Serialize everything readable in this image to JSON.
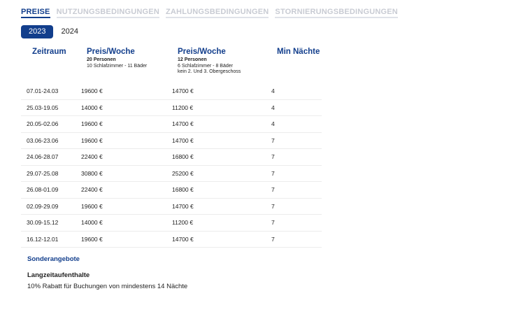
{
  "tabs": [
    {
      "label": "PREISE",
      "active": true
    },
    {
      "label": "NUTZUNGSBEDINGUNGEN",
      "active": false
    },
    {
      "label": "ZAHLUNGSBEDINGUNGEN",
      "active": false
    },
    {
      "label": "STORNIERUNGSBEDINGUNGEN",
      "active": false
    }
  ],
  "years": [
    {
      "label": "2023",
      "active": true
    },
    {
      "label": "2024",
      "active": false
    }
  ],
  "headers": {
    "period": {
      "title": "Zeitraum"
    },
    "price1": {
      "title": "Preis/Woche",
      "persons": "20 Personen",
      "details": [
        "10 Schlafzimmer - 11 Bäder"
      ]
    },
    "price2": {
      "title": "Preis/Woche",
      "persons": "12 Personen",
      "details": [
        "6 Schlafzimmer - 8 Bäder",
        "kein 2. Und 3. Obergeschoss"
      ]
    },
    "min_nights": {
      "title": "Min Nächte"
    }
  },
  "rows": [
    {
      "period": "07.01-24.03",
      "price1": "19600 €",
      "price2": "14700 €",
      "min": "4"
    },
    {
      "period": "25.03-19.05",
      "price1": "14000 €",
      "price2": "11200 €",
      "min": "4"
    },
    {
      "period": "20.05-02.06",
      "price1": "19600 €",
      "price2": "14700 €",
      "min": "4"
    },
    {
      "period": "03.06-23.06",
      "price1": "19600 €",
      "price2": "14700 €",
      "min": "7"
    },
    {
      "period": "24.06-28.07",
      "price1": "22400 €",
      "price2": "16800 €",
      "min": "7"
    },
    {
      "period": "29.07-25.08",
      "price1": "30800 €",
      "price2": "25200 €",
      "min": "7"
    },
    {
      "period": "26.08-01.09",
      "price1": "22400 €",
      "price2": "16800 €",
      "min": "7"
    },
    {
      "period": "02.09-29.09",
      "price1": "19600 €",
      "price2": "14700 €",
      "min": "7"
    },
    {
      "period": "30.09-15.12",
      "price1": "14000 €",
      "price2": "11200 €",
      "min": "7"
    },
    {
      "period": "16.12-12.01",
      "price1": "19600 €",
      "price2": "14700 €",
      "min": "7"
    }
  ],
  "special": {
    "title": "Sonderangebote",
    "subtitle": "Langzeitaufenthalte",
    "text": "10% Rabatt für Buchungen von mindestens 14 Nächte"
  },
  "colors": {
    "accent": "#123e8c",
    "inactive_tab": "#c8cbd3",
    "divider": "#ececec"
  }
}
